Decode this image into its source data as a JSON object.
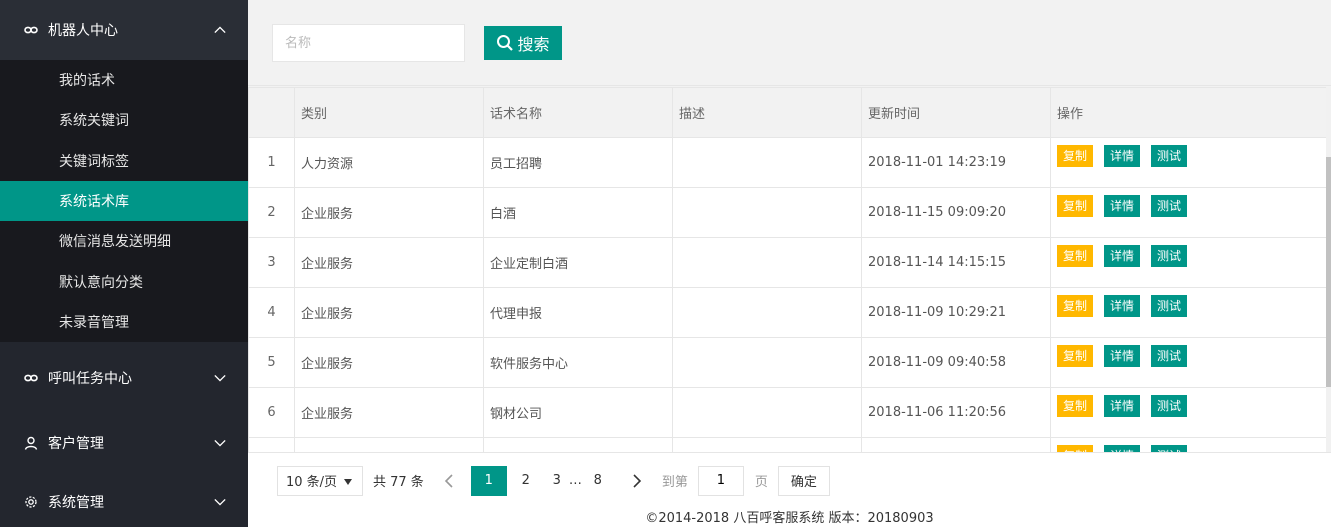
{
  "sidebar": {
    "groups": [
      {
        "label": "机器人中心",
        "icon": "link-icon",
        "expanded": true,
        "children": [
          {
            "label": "我的话术"
          },
          {
            "label": "系统关键词"
          },
          {
            "label": "关键词标签"
          },
          {
            "label": "系统话术库",
            "active": true
          },
          {
            "label": "微信消息发送明细"
          },
          {
            "label": "默认意向分类"
          },
          {
            "label": "未录音管理"
          }
        ]
      },
      {
        "label": "呼叫任务中心",
        "icon": "link-icon",
        "expanded": false
      },
      {
        "label": "客户管理",
        "icon": "user-icon",
        "expanded": false
      },
      {
        "label": "系统管理",
        "icon": "gear-icon",
        "expanded": false
      }
    ]
  },
  "search": {
    "placeholder": "名称",
    "button_label": "搜索"
  },
  "table": {
    "headers": [
      "",
      "类别",
      "话术名称",
      "描述",
      "更新时间",
      "操作"
    ],
    "rows": [
      {
        "num": "1",
        "category": "人力资源",
        "name": "员工招聘",
        "desc": "",
        "updated": "2018-11-01 14:23:19"
      },
      {
        "num": "2",
        "category": "企业服务",
        "name": "白酒",
        "desc": "",
        "updated": "2018-11-15 09:09:20"
      },
      {
        "num": "3",
        "category": "企业服务",
        "name": "企业定制白酒",
        "desc": "",
        "updated": "2018-11-14 14:15:15"
      },
      {
        "num": "4",
        "category": "企业服务",
        "name": "代理申报",
        "desc": "",
        "updated": "2018-11-09 10:29:21"
      },
      {
        "num": "5",
        "category": "企业服务",
        "name": "软件服务中心",
        "desc": "",
        "updated": "2018-11-09 09:40:58"
      },
      {
        "num": "6",
        "category": "企业服务",
        "name": "钢材公司",
        "desc": "",
        "updated": "2018-11-06 11:20:56"
      },
      {
        "num": "",
        "category": "",
        "name": "",
        "desc": "",
        "updated": ""
      }
    ],
    "actions": {
      "copy": "复制",
      "detail": "详情",
      "test": "测试"
    },
    "colors": {
      "copy": "#ffb800",
      "detail": "#009688",
      "test": "#009688"
    }
  },
  "pagination": {
    "per_page": "10 条/页",
    "total": "共 77 条",
    "pages": [
      "1",
      "2",
      "3"
    ],
    "ellipsis": "…",
    "last_page": "8",
    "current": "1",
    "goto_label": "到第",
    "goto_value": "1",
    "page_suffix": "页",
    "confirm": "确定"
  },
  "footer": "©2014-2018 八百呼客服系统 版本：20180903",
  "colors": {
    "accent": "#009688",
    "sidebar_bg": "#23262e",
    "warn": "#ffb800"
  }
}
